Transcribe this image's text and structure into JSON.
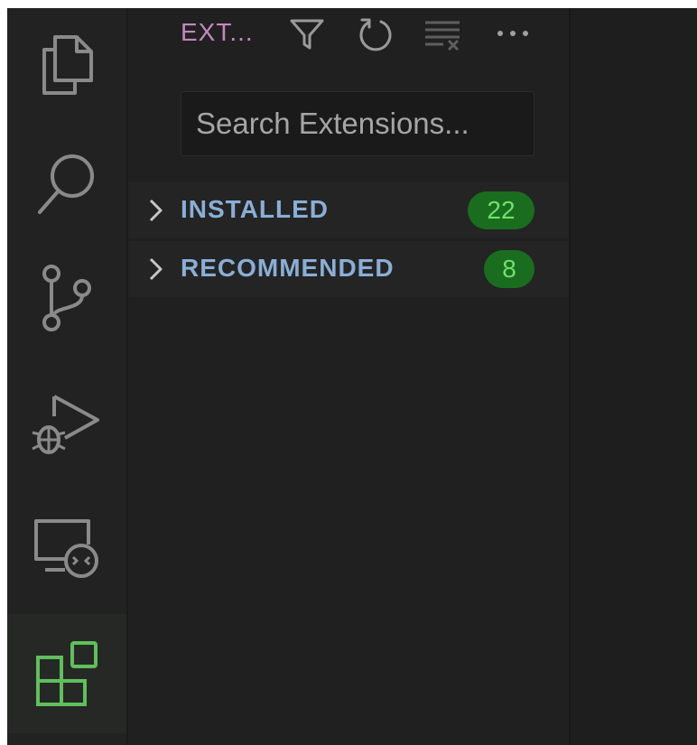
{
  "activity_bar": {
    "items": [
      {
        "name": "explorer",
        "icon": "files-icon"
      },
      {
        "name": "search",
        "icon": "search-icon"
      },
      {
        "name": "source-control",
        "icon": "source-control-icon"
      },
      {
        "name": "run-and-debug",
        "icon": "debug-icon"
      },
      {
        "name": "remote-explorer",
        "icon": "remote-explorer-icon"
      },
      {
        "name": "extensions",
        "icon": "extensions-icon",
        "active": true
      }
    ]
  },
  "sidebar": {
    "title": "EXT...",
    "actions": [
      "filter-icon",
      "refresh-icon",
      "clear-results-icon",
      "more-actions-icon"
    ],
    "search": {
      "placeholder": "Search Extensions...",
      "value": ""
    },
    "sections": [
      {
        "label": "INSTALLED",
        "count": "22"
      },
      {
        "label": "RECOMMENDED",
        "count": "8"
      }
    ]
  },
  "colors": {
    "title": "#c586c0",
    "section_label": "#8aaed6",
    "badge_bg": "#1a6d1f",
    "badge_text": "#6fe06a",
    "icon": "#8a8a8a",
    "active_icon": "#5fbf5c"
  }
}
